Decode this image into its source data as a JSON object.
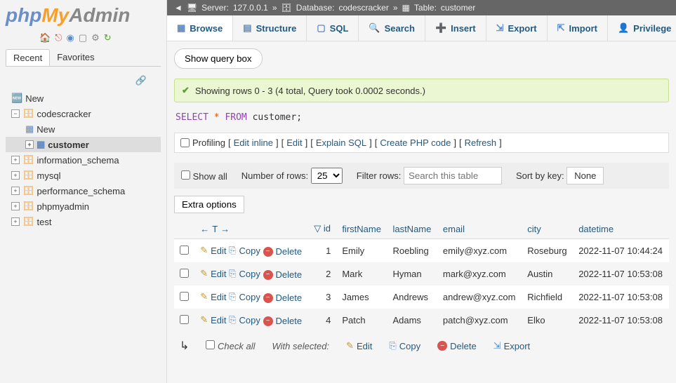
{
  "logo": {
    "php": "php",
    "my": "My",
    "admin": "Admin"
  },
  "sidebar_tabs": {
    "recent": "Recent",
    "favorites": "Favorites"
  },
  "tree": {
    "new": "New",
    "codescracker": "codescracker",
    "cc_new": "New",
    "customer": "customer",
    "information_schema": "information_schema",
    "mysql": "mysql",
    "performance_schema": "performance_schema",
    "phpmyadmin": "phpmyadmin",
    "test": "test"
  },
  "breadcrumb": {
    "server_label": "Server:",
    "server": "127.0.0.1",
    "db_label": "Database:",
    "db": "codescracker",
    "table_label": "Table:",
    "table": "customer"
  },
  "tabs": {
    "browse": "Browse",
    "structure": "Structure",
    "sql": "SQL",
    "search": "Search",
    "insert": "Insert",
    "export": "Export",
    "import": "Import",
    "privileges": "Privilege"
  },
  "show_query_box": "Show query box",
  "status": "Showing rows 0 - 3 (4 total, Query took 0.0002 seconds.)",
  "sql": {
    "select": "SELECT",
    "star": "*",
    "from": "FROM",
    "target": "customer;"
  },
  "profiling": {
    "label": "Profiling",
    "edit_inline": "Edit inline",
    "edit": "Edit",
    "explain": "Explain SQL",
    "create_php": "Create PHP code",
    "refresh": "Refresh"
  },
  "controls": {
    "show_all": "Show all",
    "num_rows": "Number of rows:",
    "num_rows_val": "25",
    "filter": "Filter rows:",
    "filter_ph": "Search this table",
    "sort_by": "Sort by key:",
    "sort_val": "None"
  },
  "extra_options": "Extra options",
  "columns": {
    "id": "id",
    "firstName": "firstName",
    "lastName": "lastName",
    "email": "email",
    "city": "city",
    "datetime": "datetime"
  },
  "actions": {
    "edit": "Edit",
    "copy": "Copy",
    "delete": "Delete"
  },
  "rows": [
    {
      "id": "1",
      "firstName": "Emily",
      "lastName": "Roebling",
      "email": "emily@xyz.com",
      "city": "Roseburg",
      "datetime": "2022-11-07 10:44:24"
    },
    {
      "id": "2",
      "firstName": "Mark",
      "lastName": "Hyman",
      "email": "mark@xyz.com",
      "city": "Austin",
      "datetime": "2022-11-07 10:53:08"
    },
    {
      "id": "3",
      "firstName": "James",
      "lastName": "Andrews",
      "email": "andrew@xyz.com",
      "city": "Richfield",
      "datetime": "2022-11-07 10:53:08"
    },
    {
      "id": "4",
      "firstName": "Patch",
      "lastName": "Adams",
      "email": "patch@xyz.com",
      "city": "Elko",
      "datetime": "2022-11-07 10:53:08"
    }
  ],
  "footer": {
    "check_all": "Check all",
    "with_selected": "With selected:",
    "edit": "Edit",
    "copy": "Copy",
    "delete": "Delete",
    "export": "Export"
  }
}
